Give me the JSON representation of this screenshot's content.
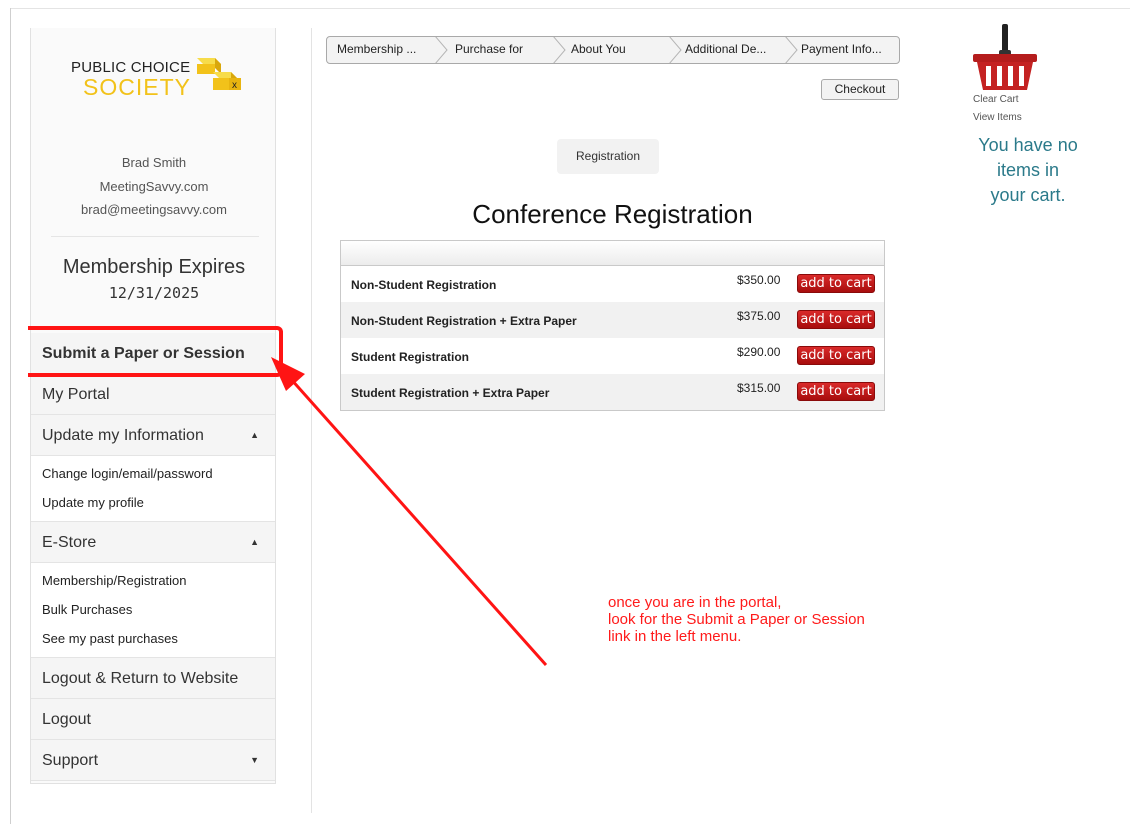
{
  "logo": {
    "line1": "PUBLIC CHOICE",
    "line2": "SOCIETY",
    "badge": "x"
  },
  "profile": {
    "name": "Brad Smith",
    "company": "MeetingSavvy.com",
    "email": "brad@meetingsavvy.com"
  },
  "membership": {
    "title": "Membership Expires",
    "date": "12/31/2025"
  },
  "menu": {
    "submit": "Submit a Paper or Session",
    "portal": "My Portal",
    "update_info": "Update my Information",
    "update_sub": [
      "Change login/email/password",
      "Update my profile"
    ],
    "estore": "E-Store",
    "estore_sub": [
      "Membership/Registration",
      "Bulk Purchases",
      "See my past purchases"
    ],
    "logout_return": "Logout & Return to Website",
    "logout": "Logout",
    "support": "Support",
    "caret_up": "▲",
    "caret_down": "▼"
  },
  "steps": [
    "Membership ...",
    "Purchase for",
    "About You",
    "Additional De...",
    "Payment Info..."
  ],
  "checkout": "Checkout",
  "tab": "Registration",
  "heading": "Conference Registration",
  "products": [
    {
      "name": "Non-Student Registration",
      "price": "$350.00",
      "button": "add to cart"
    },
    {
      "name": "Non-Student Registration + Extra Paper",
      "price": "$375.00",
      "button": "add to cart"
    },
    {
      "name": "Student Registration",
      "price": "$290.00",
      "button": "add to cart"
    },
    {
      "name": "Student Registration + Extra Paper",
      "price": "$315.00",
      "button": "add to cart"
    }
  ],
  "cart": {
    "clear": "Clear Cart",
    "view": "View Items",
    "message": [
      "You have no",
      "items in",
      "your cart."
    ]
  },
  "annotation": [
    "once you are in the portal,",
    "look for the Submit a Paper or Session",
    "link in the left menu."
  ],
  "colors": {
    "accent_red": "#ff1414",
    "logo_yellow": "#f2c21a",
    "cart_text": "#2b7a8a",
    "button_red": "#c41a1a"
  }
}
